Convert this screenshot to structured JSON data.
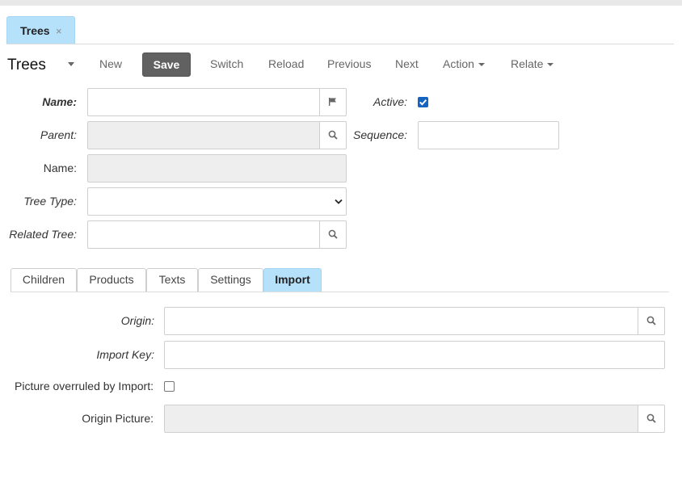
{
  "doc_tab": {
    "label": "Trees",
    "close_glyph": "×"
  },
  "toolbar": {
    "title": "Trees",
    "new_label": "New",
    "save_label": "Save",
    "switch_label": "Switch",
    "reload_label": "Reload",
    "previous_label": "Previous",
    "next_label": "Next",
    "action_label": "Action",
    "relate_label": "Relate"
  },
  "form": {
    "name_label": "Name:",
    "name_value": "",
    "parent_label": "Parent:",
    "parent_value": "",
    "record_name_label": "Name:",
    "record_name_value": "",
    "tree_type_label": "Tree Type:",
    "tree_type_value": "",
    "related_tree_label": "Related Tree:",
    "related_tree_value": "",
    "active_label": "Active:",
    "active_checked": true,
    "sequence_label": "Sequence:",
    "sequence_value": ""
  },
  "subtabs": [
    {
      "label": "Children",
      "active": false
    },
    {
      "label": "Products",
      "active": false
    },
    {
      "label": "Texts",
      "active": false
    },
    {
      "label": "Settings",
      "active": false
    },
    {
      "label": "Import",
      "active": true
    }
  ],
  "import": {
    "origin_label": "Origin:",
    "origin_value": "",
    "import_key_label": "Import Key:",
    "import_key_value": "",
    "picture_overruled_label": "Picture overruled by Import:",
    "picture_overruled_checked": false,
    "origin_picture_label": "Origin Picture:",
    "origin_picture_value": ""
  },
  "icons": {
    "flag": "flag-icon",
    "search": "search-icon",
    "close": "close-icon",
    "caret": "caret-down-icon"
  },
  "colors": {
    "accent_tab": "#b6e1fb",
    "save_button": "#616161",
    "checkbox": "#1565c0",
    "readonly_field": "#eeeeee"
  }
}
